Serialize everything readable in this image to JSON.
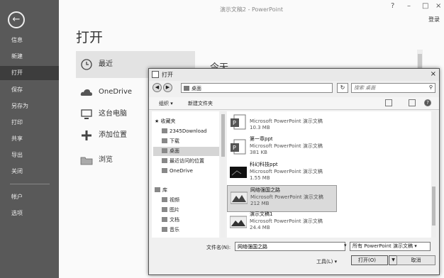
{
  "window": {
    "title": "演示文稿2 - PowerPoint",
    "sign_in": "登录"
  },
  "backstage": {
    "items": [
      "信息",
      "新建",
      "打开",
      "保存",
      "另存为",
      "打印",
      "共享",
      "导出",
      "关闭",
      "帐户",
      "选项"
    ],
    "active": "打开"
  },
  "open_page": {
    "title": "打开",
    "locations": [
      "最近",
      "OneDrive",
      "这台电脑",
      "添加位置",
      "浏览"
    ],
    "section_today": "今天"
  },
  "dialog": {
    "title": "打开",
    "address": "桌面",
    "search_placeholder": "搜索 桌面",
    "toolbar": {
      "organize": "组织",
      "new_folder": "新建文件夹"
    },
    "nav": {
      "favorites_header": "收藏夹",
      "favorites": [
        "2345Download",
        "下载",
        "桌面",
        "最近访问的位置",
        "OneDrive"
      ],
      "selected": "桌面",
      "library_header": "库",
      "libraries": [
        "视频",
        "图片",
        "文档",
        "音乐"
      ]
    },
    "files": [
      {
        "name": "",
        "type": "Microsoft PowerPoint 演示文稿",
        "size": "10.3 MB"
      },
      {
        "name": "第一章ppt",
        "type": "Microsoft PowerPoint 演示文稿",
        "size": "381 KB"
      },
      {
        "name": "科幻科技ppt",
        "type": "Microsoft PowerPoint 演示文稿",
        "size": "1.55 MB"
      },
      {
        "name": "网络强国之路",
        "type": "Microsoft PowerPoint 演示文稿",
        "size": "212 MB"
      },
      {
        "name": "演示文稿1",
        "type": "Microsoft PowerPoint 演示文稿",
        "size": "24.4 MB"
      }
    ],
    "selected_file": "网络强国之路",
    "filename_label": "文件名(N):",
    "filename_value": "网络强国之路",
    "filetype_value": "所有 PowerPoint 演示文稿",
    "tools_label": "工具(L)",
    "open_label": "打开(O)",
    "cancel_label": "取消"
  }
}
